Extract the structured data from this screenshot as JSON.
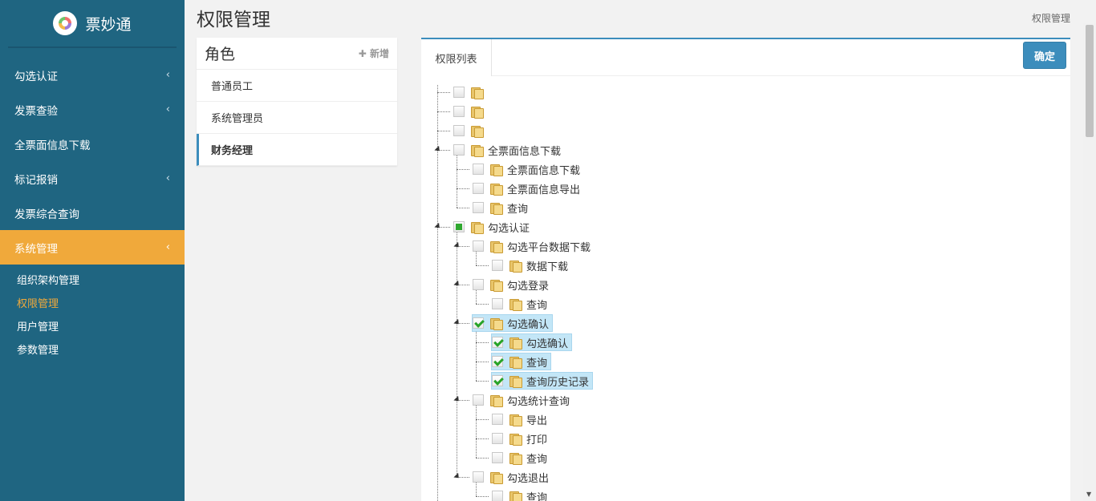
{
  "brand": {
    "name": "票妙通"
  },
  "nav": [
    {
      "label": "勾选认证",
      "chevron": "‹"
    },
    {
      "label": "发票查验",
      "chevron": "‹"
    },
    {
      "label": "全票面信息下载"
    },
    {
      "label": "标记报销",
      "chevron": "‹"
    },
    {
      "label": "发票综合查询"
    },
    {
      "label": "系统管理",
      "chevron": "‹",
      "active": true
    }
  ],
  "subnav": [
    {
      "label": "组织架构管理"
    },
    {
      "label": "权限管理",
      "current": true
    },
    {
      "label": "用户管理"
    },
    {
      "label": "参数管理"
    }
  ],
  "page": {
    "title": "权限管理",
    "breadcrumb": "权限管理"
  },
  "roles": {
    "title": "角色",
    "add_label": "✚ 新增",
    "items": [
      {
        "label": "普通员工"
      },
      {
        "label": "系统管理员"
      },
      {
        "label": "财务经理",
        "selected": true
      }
    ]
  },
  "permissions": {
    "tab": "权限列表",
    "confirm_label": "确定",
    "tree": [
      {
        "level": 0,
        "label": "",
        "state": "none"
      },
      {
        "level": 0,
        "label": "",
        "state": "none"
      },
      {
        "level": 0,
        "label": "",
        "state": "none"
      },
      {
        "level": 0,
        "label": "全票面信息下载",
        "state": "none",
        "expanded": true
      },
      {
        "level": 1,
        "label": "全票面信息下载",
        "state": "none"
      },
      {
        "level": 1,
        "label": "全票面信息导出",
        "state": "none"
      },
      {
        "level": 1,
        "label": "查询",
        "state": "none"
      },
      {
        "level": 0,
        "label": "勾选认证",
        "state": "partial",
        "expanded": true
      },
      {
        "level": 1,
        "label": "勾选平台数据下载",
        "state": "none",
        "expanded": true
      },
      {
        "level": 2,
        "label": "数据下载",
        "state": "none"
      },
      {
        "level": 1,
        "label": "勾选登录",
        "state": "none",
        "expanded": true
      },
      {
        "level": 2,
        "label": "查询",
        "state": "none"
      },
      {
        "level": 1,
        "label": "勾选确认",
        "state": "checked",
        "expanded": true,
        "highlight": true
      },
      {
        "level": 2,
        "label": "勾选确认",
        "state": "checked",
        "highlight": true
      },
      {
        "level": 2,
        "label": "查询",
        "state": "checked",
        "highlight": true
      },
      {
        "level": 2,
        "label": "查询历史记录",
        "state": "checked",
        "highlight": true
      },
      {
        "level": 1,
        "label": "勾选统计查询",
        "state": "none",
        "expanded": true
      },
      {
        "level": 2,
        "label": "导出",
        "state": "none"
      },
      {
        "level": 2,
        "label": "打印",
        "state": "none"
      },
      {
        "level": 2,
        "label": "查询",
        "state": "none"
      },
      {
        "level": 1,
        "label": "勾选退出",
        "state": "none",
        "expanded": true
      },
      {
        "level": 2,
        "label": "查询",
        "state": "none"
      }
    ]
  },
  "colors": {
    "sidebar": "#1f6581",
    "accent": "#f0a93b",
    "primary": "#3c8dbc"
  },
  "icons": {
    "folder": "folder-icon",
    "expand": "expand-triangle-icon",
    "chevron": "chevron-left-icon"
  }
}
